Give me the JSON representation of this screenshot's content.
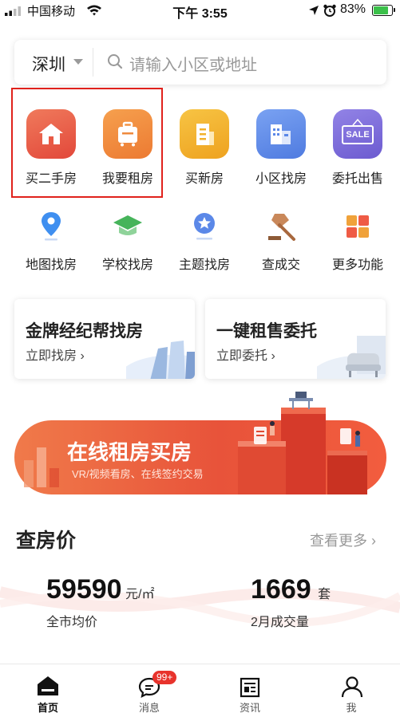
{
  "status_bar": {
    "carrier": "中国移动",
    "time": "下午 3:55",
    "battery": "83%"
  },
  "search": {
    "city": "深圳",
    "placeholder": "请输入小区或地址"
  },
  "main_icons": [
    {
      "label": "买二手房",
      "icon": "house-icon",
      "color": "#e95a45"
    },
    {
      "label": "我要租房",
      "icon": "luggage-icon",
      "color": "#f08a3e"
    },
    {
      "label": "买新房",
      "icon": "building-icon",
      "color": "#f2b12b"
    },
    {
      "label": "小区找房",
      "icon": "community-icon",
      "color": "#5b88e8"
    },
    {
      "label": "委托出售",
      "icon": "sale-sign-icon",
      "color": "#7b6bd6",
      "icon_text": "SALE"
    }
  ],
  "sub_icons": [
    {
      "label": "地图找房",
      "icon": "map-pin-icon"
    },
    {
      "label": "学校找房",
      "icon": "graduation-cap-icon"
    },
    {
      "label": "主题找房",
      "icon": "star-badge-icon"
    },
    {
      "label": "查成交",
      "icon": "gavel-icon"
    },
    {
      "label": "更多功能",
      "icon": "grid-icon"
    }
  ],
  "cards": [
    {
      "title": "金牌经纪帮找房",
      "link": "立即找房 ›"
    },
    {
      "title": "一键租售委托",
      "link": "立即委托 ›"
    }
  ],
  "banner": {
    "title": "在线租房买房",
    "subtitle": "VR/视频看房、在线签约交易"
  },
  "price_section": {
    "title": "查房价",
    "more": "查看更多 ›",
    "stats": [
      {
        "value": "59590",
        "unit": "元/㎡",
        "label": "全市均价"
      },
      {
        "value": "1669",
        "unit": "套",
        "label": "2月成交量"
      }
    ]
  },
  "tabs": [
    {
      "label": "首页",
      "icon": "home-icon",
      "active": true
    },
    {
      "label": "消息",
      "icon": "message-icon",
      "badge": "99+"
    },
    {
      "label": "资讯",
      "icon": "news-icon"
    },
    {
      "label": "我",
      "icon": "user-icon"
    }
  ],
  "colors": {
    "accent": "#e8533a",
    "highlight_box": "#e0221c",
    "battery_fill": "#3bc04a"
  }
}
